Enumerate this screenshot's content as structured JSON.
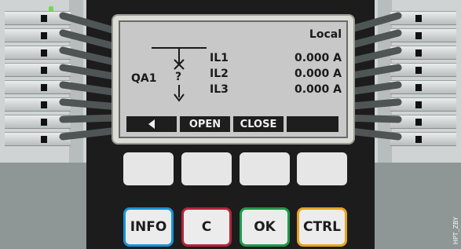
{
  "screen": {
    "status": "Local",
    "device_id": "QA1",
    "switch_state_symbol": "?",
    "currents": [
      {
        "label": "IL1",
        "value": "0.000 A"
      },
      {
        "label": "IL2",
        "value": "0.000 A"
      },
      {
        "label": "IL3",
        "value": "0.000 A"
      }
    ],
    "softkeys": {
      "back_icon": "left-triangle-icon",
      "open": "OPEN",
      "close": "CLOSE",
      "empty": ""
    }
  },
  "buttons": {
    "info": {
      "label": "INFO",
      "color": "#1a93d4"
    },
    "clear": {
      "label": "C",
      "color": "#b2263a"
    },
    "ok": {
      "label": "OK",
      "color": "#1f9a4a"
    },
    "ctrl": {
      "label": "CTRL",
      "color": "#e6a51f"
    }
  },
  "watermark": "HPT_ZBY",
  "colors": {
    "device_body": "#1c1c1c",
    "lcd_background": "#c8c8c8",
    "led": "#6fdc4a"
  }
}
